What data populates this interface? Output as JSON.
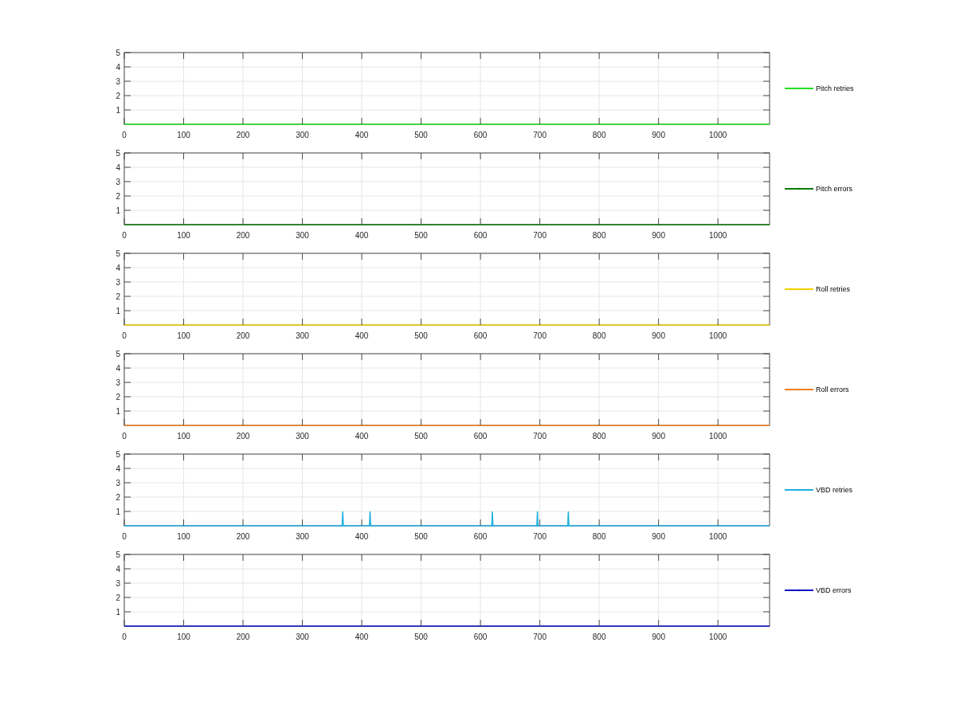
{
  "charts": [
    {
      "chart_data": {
        "type": "line",
        "x": [
          0,
          1087
        ],
        "series": [
          {
            "name": "Pitch retries",
            "color": "#22e022",
            "values": [
              0,
              0
            ]
          }
        ],
        "xlim": [
          0,
          1087
        ],
        "ylim": [
          0,
          5
        ],
        "xticks": [
          0,
          100,
          200,
          300,
          400,
          500,
          600,
          700,
          800,
          900,
          1000
        ],
        "yticks": [
          1,
          2,
          3,
          4,
          5
        ],
        "grid": true
      }
    },
    {
      "chart_data": {
        "type": "line",
        "x": [
          0,
          1087
        ],
        "series": [
          {
            "name": "Pitch errors",
            "color": "#0a7a0a",
            "values": [
              0,
              0
            ]
          }
        ],
        "xlim": [
          0,
          1087
        ],
        "ylim": [
          0,
          5
        ],
        "xticks": [
          0,
          100,
          200,
          300,
          400,
          500,
          600,
          700,
          800,
          900,
          1000
        ],
        "yticks": [
          1,
          2,
          3,
          4,
          5
        ],
        "grid": true
      }
    },
    {
      "chart_data": {
        "type": "line",
        "x": [
          0,
          1087
        ],
        "series": [
          {
            "name": "Roll retries",
            "color": "#f5d000",
            "values": [
              0,
              0
            ]
          }
        ],
        "xlim": [
          0,
          1087
        ],
        "ylim": [
          0,
          5
        ],
        "xticks": [
          0,
          100,
          200,
          300,
          400,
          500,
          600,
          700,
          800,
          900,
          1000
        ],
        "yticks": [
          1,
          2,
          3,
          4,
          5
        ],
        "grid": true
      }
    },
    {
      "chart_data": {
        "type": "line",
        "x": [
          0,
          1087
        ],
        "series": [
          {
            "name": "Roll errors",
            "color": "#f08020",
            "values": [
              0,
              0
            ]
          }
        ],
        "xlim": [
          0,
          1087
        ],
        "ylim": [
          0,
          5
        ],
        "xticks": [
          0,
          100,
          200,
          300,
          400,
          500,
          600,
          700,
          800,
          900,
          1000
        ],
        "yticks": [
          1,
          2,
          3,
          4,
          5
        ],
        "grid": true
      }
    },
    {
      "chart_data": {
        "type": "line",
        "x": [
          0,
          367,
          368,
          369,
          413,
          414,
          415,
          619,
          620,
          621,
          695,
          696,
          697,
          747,
          748,
          749,
          1087
        ],
        "series": [
          {
            "name": "VBD retries",
            "color": "#20b0e0",
            "values": [
              0,
              0,
              1,
              0,
              0,
              1,
              0,
              0,
              1,
              0,
              0,
              1,
              0,
              0,
              1,
              0,
              0
            ]
          }
        ],
        "xlim": [
          0,
          1087
        ],
        "ylim": [
          0,
          5
        ],
        "xticks": [
          0,
          100,
          200,
          300,
          400,
          500,
          600,
          700,
          800,
          900,
          1000
        ],
        "yticks": [
          1,
          2,
          3,
          4,
          5
        ],
        "grid": true
      }
    },
    {
      "chart_data": {
        "type": "line",
        "x": [
          0,
          1087
        ],
        "series": [
          {
            "name": "VBD errors",
            "color": "#0a10c0",
            "values": [
              0,
              0
            ]
          }
        ],
        "xlim": [
          0,
          1087
        ],
        "ylim": [
          0,
          5
        ],
        "xticks": [
          0,
          100,
          200,
          300,
          400,
          500,
          600,
          700,
          800,
          900,
          1000
        ],
        "yticks": [
          1,
          2,
          3,
          4,
          5
        ],
        "grid": true
      }
    }
  ]
}
